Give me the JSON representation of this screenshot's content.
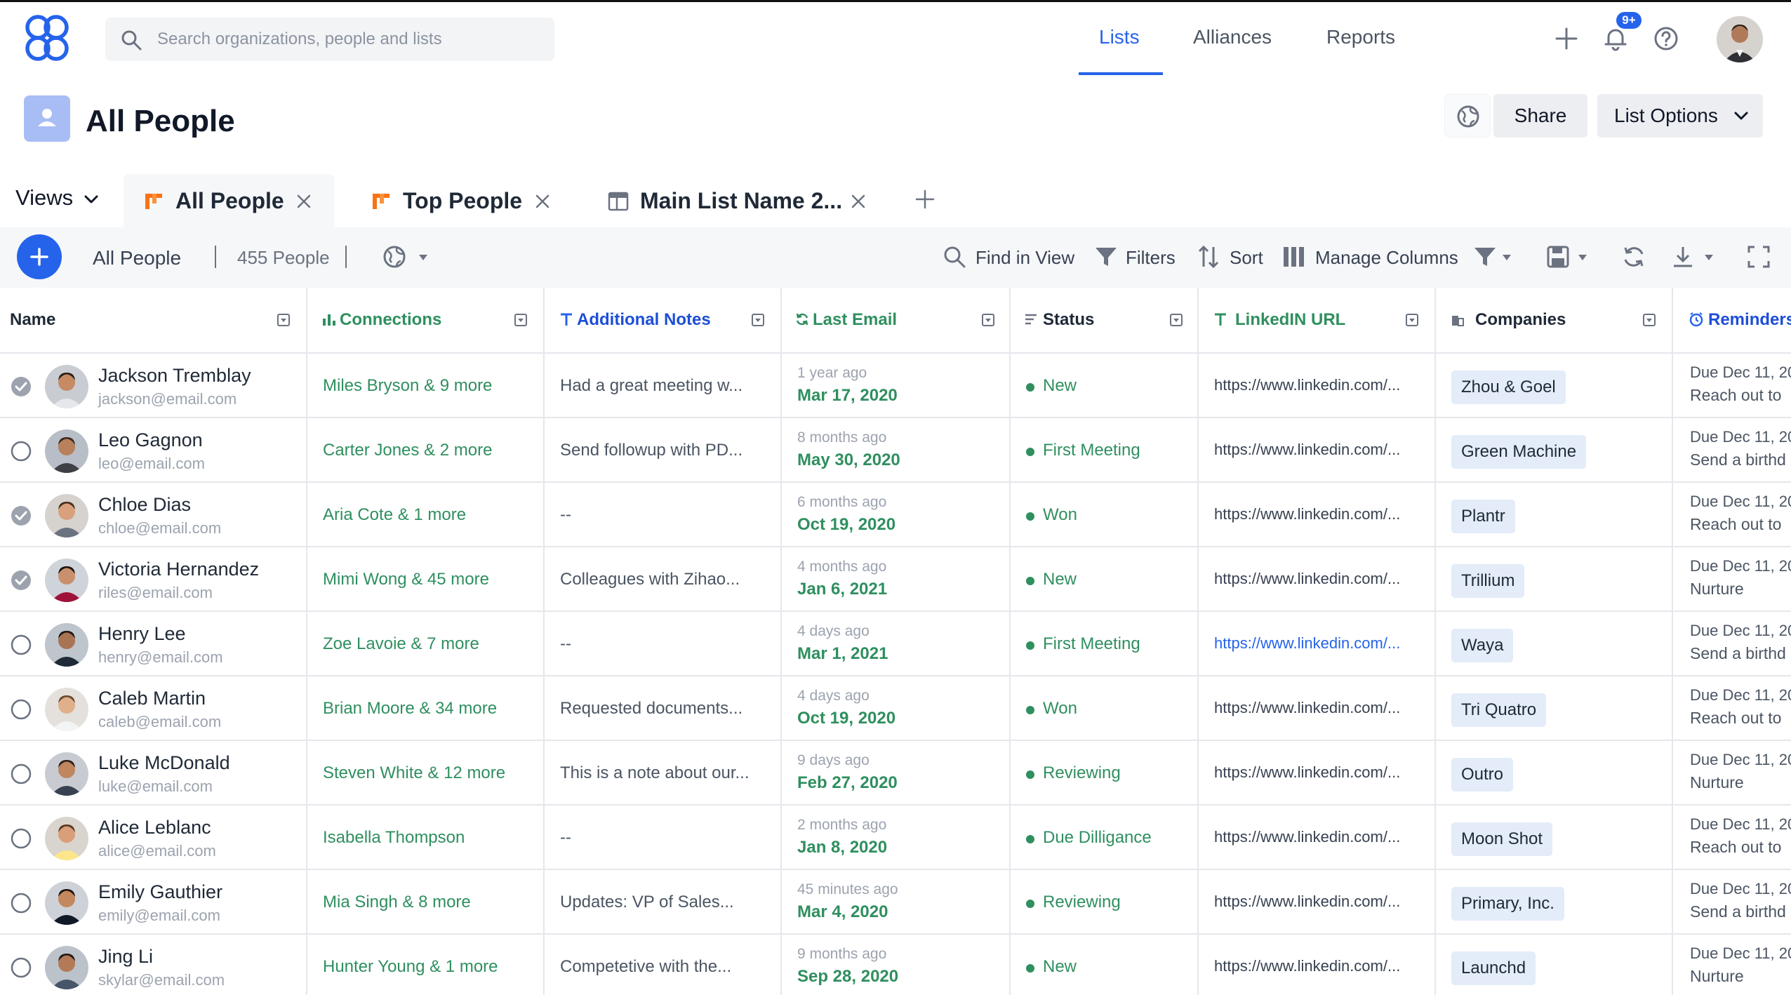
{
  "search": {
    "placeholder": "Search organizations, people and lists"
  },
  "nav": {
    "lists": "Lists",
    "alliances": "Alliances",
    "reports": "Reports"
  },
  "notifications": {
    "badge": "9+"
  },
  "page": {
    "title": "All People",
    "share": "Share",
    "list_options": "List Options"
  },
  "views": {
    "label": "Views",
    "tabs": [
      {
        "label": "All People",
        "active": true
      },
      {
        "label": "Top People",
        "active": false
      },
      {
        "label": "Main List Name 2...",
        "active": false
      }
    ]
  },
  "toolbar": {
    "view_name": "All People",
    "count": "455 People",
    "find": "Find in View",
    "filters": "Filters",
    "sort": "Sort",
    "manage_columns": "Manage Columns"
  },
  "columns": {
    "name": "Name",
    "connections": "Connections",
    "notes": "Additional Notes",
    "last_email": "Last Email",
    "status": "Status",
    "linkedin": "LinkedIN URL",
    "companies": "Companies",
    "reminders": "Reminders"
  },
  "colors": {
    "accent": "#2563eb",
    "green": "#2f8f5f",
    "company_chip": "#e3ecf8",
    "toolbar_bg": "#f6f7f9"
  },
  "rows": [
    {
      "checked": true,
      "name": "Jackson Tremblay",
      "email": "jackson@email.com",
      "connections": "Miles Bryson & 9 more",
      "notes": "Had a great meeting w...",
      "ago": "1 year ago",
      "date": "Mar 17, 2020",
      "status": "New",
      "url": "https://www.linkedin.com/...",
      "url_link": false,
      "company": "Zhou & Goel",
      "due": "Due Dec 11, 20",
      "reminder": "Reach out to"
    },
    {
      "checked": false,
      "name": "Leo Gagnon",
      "email": "leo@email.com",
      "connections": "Carter Jones & 2 more",
      "notes": "Send followup with PD...",
      "ago": "8 months ago",
      "date": "May 30, 2020",
      "status": "First Meeting",
      "url": "https://www.linkedin.com/...",
      "url_link": false,
      "company": "Green Machine",
      "due": "Due Dec 11, 20",
      "reminder": "Send a birthd"
    },
    {
      "checked": true,
      "name": "Chloe Dias",
      "email": "chloe@email.com",
      "connections": "Aria Cote & 1 more",
      "notes": "--",
      "ago": "6 months ago",
      "date": "Oct 19, 2020",
      "status": "Won",
      "url": "https://www.linkedin.com/...",
      "url_link": false,
      "company": "Plantr",
      "due": "Due Dec 11, 20",
      "reminder": "Reach out to"
    },
    {
      "checked": true,
      "name": "Victoria Hernandez",
      "email": "riles@email.com",
      "connections": "Mimi Wong & 45 more",
      "notes": "Colleagues with Zihao...",
      "ago": "4 months ago",
      "date": "Jan 6, 2021",
      "status": "New",
      "url": "https://www.linkedin.com/...",
      "url_link": false,
      "company": "Trillium",
      "due": "Due Dec 11, 20",
      "reminder": "Nurture"
    },
    {
      "checked": false,
      "name": "Henry Lee",
      "email": "henry@email.com",
      "connections": "Zoe Lavoie & 7 more",
      "notes": "--",
      "ago": "4 days ago",
      "date": "Mar 1, 2021",
      "status": "First Meeting",
      "url": "https://www.linkedin.com/...",
      "url_link": true,
      "company": "Waya",
      "due": "Due Dec 11, 20",
      "reminder": "Send a birthd"
    },
    {
      "checked": false,
      "name": "Caleb Martin",
      "email": "caleb@email.com",
      "connections": "Brian Moore & 34 more",
      "notes": "Requested documents...",
      "ago": "4 days ago",
      "date": "Oct 19, 2020",
      "status": "Won",
      "url": "https://www.linkedin.com/...",
      "url_link": false,
      "company": "Tri Quatro",
      "due": "Due Dec 11, 20",
      "reminder": "Reach out to"
    },
    {
      "checked": false,
      "name": "Luke McDonald",
      "email": "luke@email.com",
      "connections": "Steven White & 12 more",
      "notes": "This is a note about our...",
      "ago": "9 days ago",
      "date": "Feb 27, 2020",
      "status": "Reviewing",
      "url": "https://www.linkedin.com/...",
      "url_link": false,
      "company": "Outro",
      "due": "Due Dec 11, 20",
      "reminder": "Nurture"
    },
    {
      "checked": false,
      "name": "Alice Leblanc",
      "email": "alice@email.com",
      "connections": "Isabella Thompson",
      "notes": "--",
      "ago": "2 months ago",
      "date": "Jan 8, 2020",
      "status": "Due Dilligance",
      "url": "https://www.linkedin.com/...",
      "url_link": false,
      "company": "Moon Shot",
      "due": "Due Dec 11, 20",
      "reminder": "Reach out to"
    },
    {
      "checked": false,
      "name": "Emily Gauthier",
      "email": "emily@email.com",
      "connections": "Mia Singh & 8 more",
      "notes": "Updates: VP of Sales...",
      "ago": "45 minutes ago",
      "date": "Mar 4, 2020",
      "status": "Reviewing",
      "url": "https://www.linkedin.com/...",
      "url_link": false,
      "company": "Primary, Inc.",
      "due": "Due Dec 11, 20",
      "reminder": "Send a birthd"
    },
    {
      "checked": false,
      "name": "Jing Li",
      "email": "skylar@email.com",
      "connections": "Hunter Young & 1 more",
      "notes": "Competetive with the...",
      "ago": "9 months ago",
      "date": "Sep 28, 2020",
      "status": "New",
      "url": "https://www.linkedin.com/...",
      "url_link": false,
      "company": "Launchd",
      "due": "Due Dec 11, 20",
      "reminder": "Nurture"
    }
  ]
}
